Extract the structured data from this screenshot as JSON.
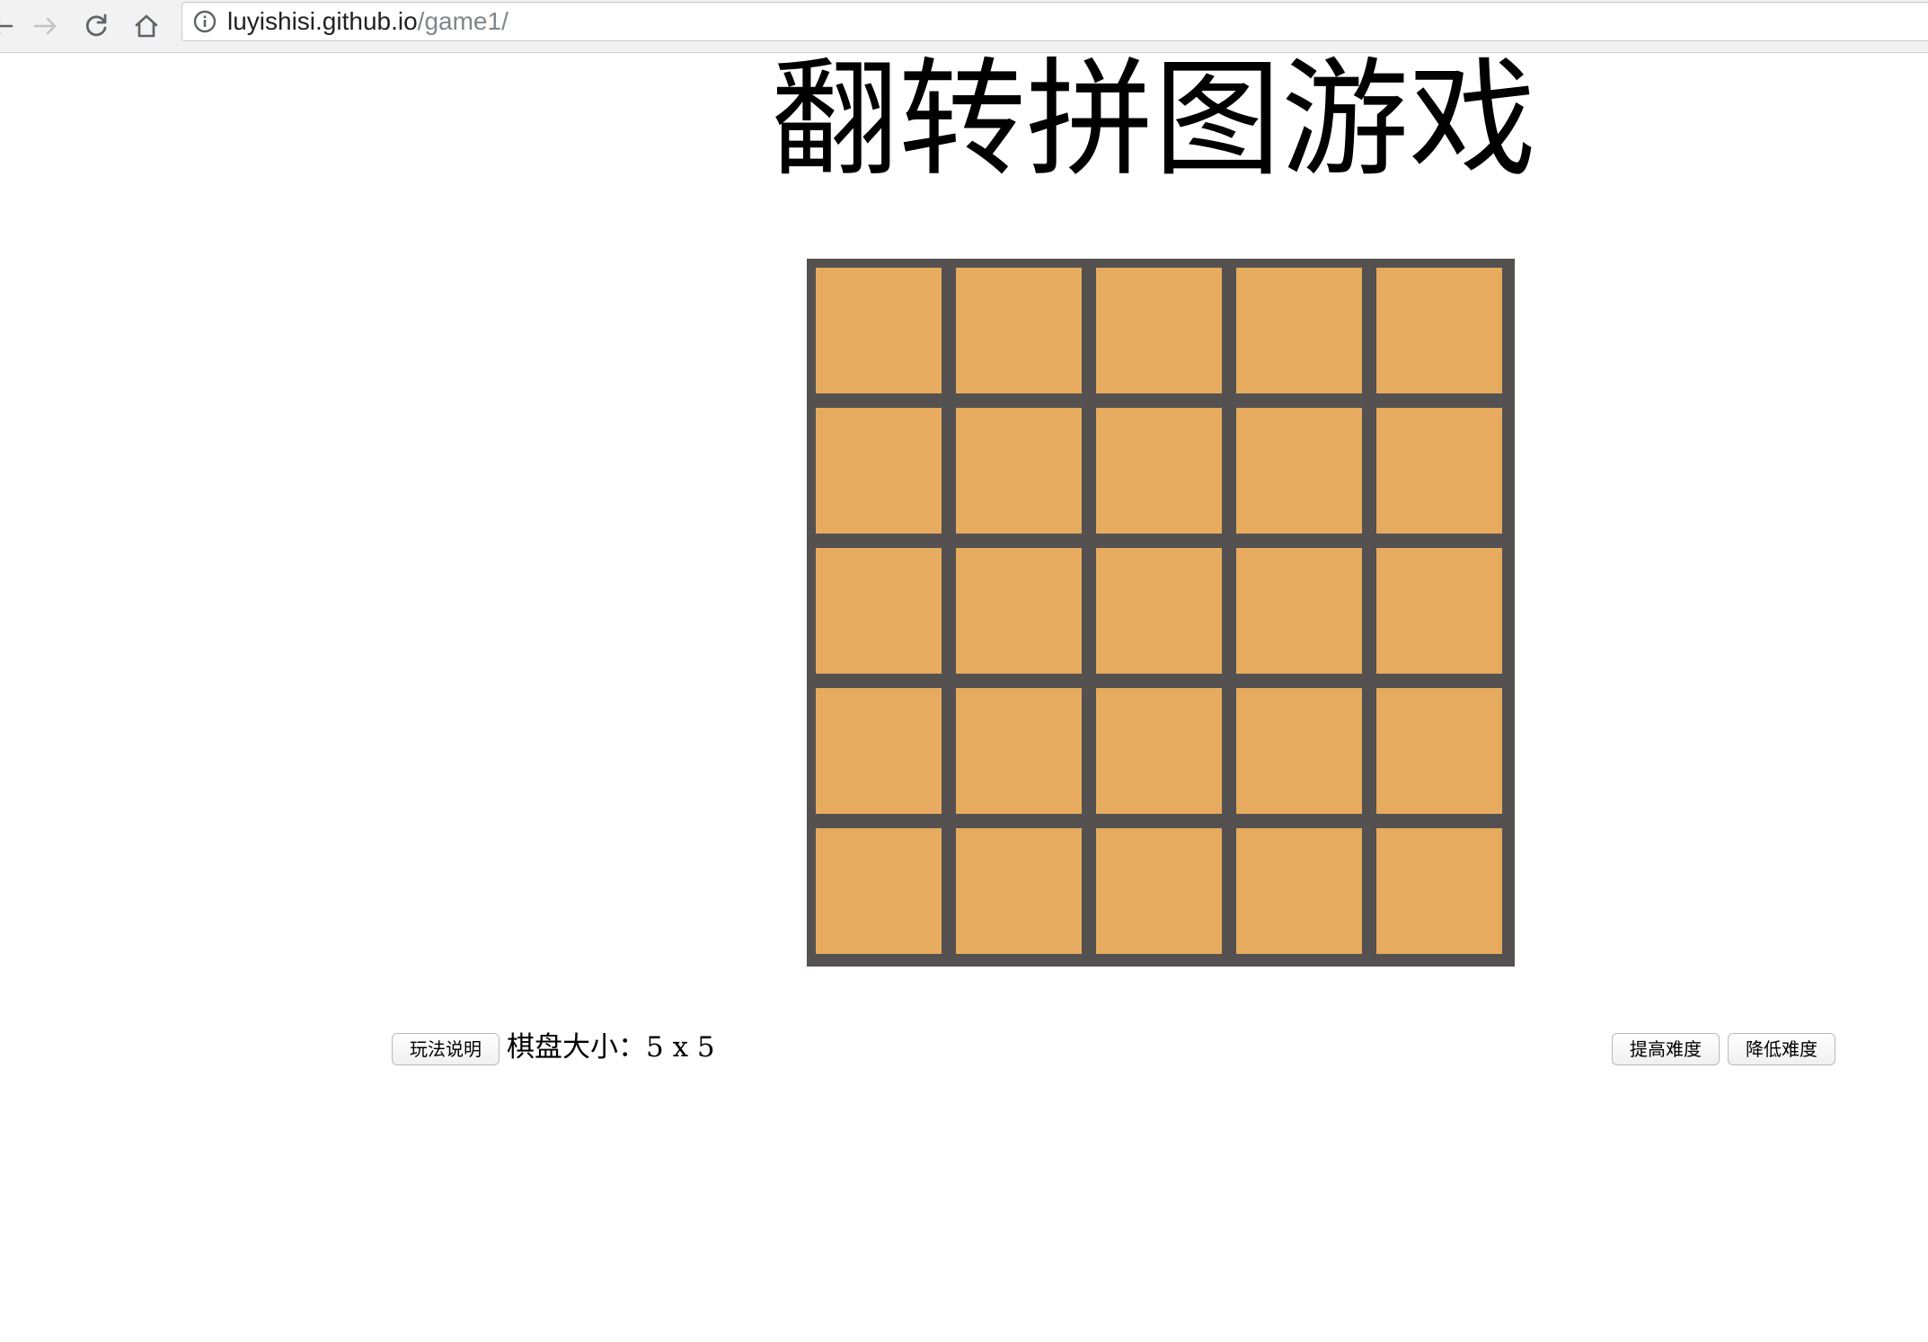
{
  "browser": {
    "url_host": "luyishisi.github.io",
    "url_path": "/game1/",
    "icons": [
      "back-icon",
      "forward-icon",
      "reload-icon",
      "home-icon",
      "info-icon"
    ]
  },
  "page": {
    "title": "翻转拼图游戏"
  },
  "board": {
    "rows": 5,
    "cols": 5,
    "cell_color": "#e6ab5f",
    "frame_color": "#545150"
  },
  "controls": {
    "help_label": "玩法说明",
    "size_label": "棋盘大小：5 x 5",
    "raise_label": "提高难度",
    "lower_label": "降低难度"
  }
}
